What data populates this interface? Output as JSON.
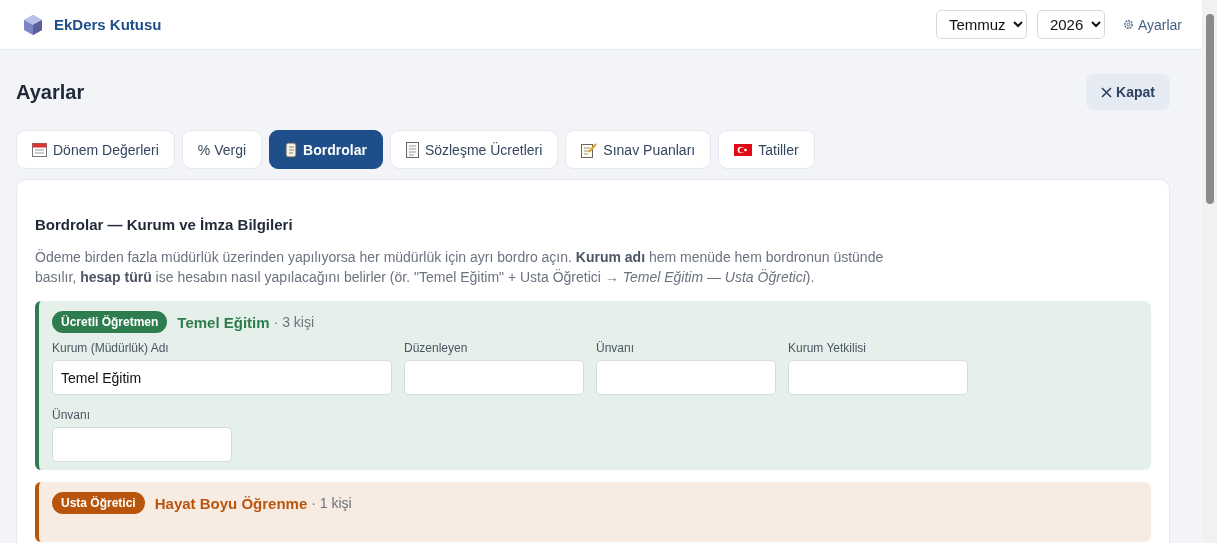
{
  "app": {
    "title": "EkDers Kutusu",
    "month": "Temmuz",
    "year": "2026",
    "settings_link": "Ayarlar"
  },
  "page": {
    "title": "Ayarlar",
    "close_button": "Kapat"
  },
  "tabs": [
    {
      "label": "Dönem Değerleri",
      "selected": false
    },
    {
      "label": "% Vergi",
      "selected": false
    },
    {
      "label": "Bordrolar",
      "selected": true
    },
    {
      "label": "Sözleşme Ücretleri",
      "selected": false
    },
    {
      "label": "Sınav Puanları",
      "selected": false
    },
    {
      "label": "Tatiller",
      "selected": false
    }
  ],
  "panel": {
    "heading": "Bordrolar — Kurum ve İmza Bilgileri",
    "description": "Ödeme birden fazla müdürlük üzerinden yapılıyorsa her müdürlük için ayrı bordro açın. **Kurum adı** hem menüde hem bordronun üstünde basılır, **hesap türü** ise hesabın nasıl yapılacağını belirler (ör. \"Temel Eğitim\" + Usta Öğretici → *Temel Eğitim — Usta Öğretici*)."
  },
  "payrolls": [
    {
      "badge": "Ücretli Öğretmen",
      "name": "Temel Eğitim",
      "count": "· 3 kişi",
      "color": "#2e7d4f",
      "fields": [
        {
          "label": "Kurum (Müdürlük) Adı",
          "value": "Temel Eğitim"
        },
        {
          "label": "Düzenleyen"
        },
        {
          "label": "Ünvanı"
        },
        {
          "label": "Kurum Yetkilisi"
        },
        {
          "label": "Ünvanı"
        }
      ]
    },
    {
      "badge": "Usta Öğretici",
      "name": "Hayat Boyu Öğrenme",
      "count": "· 1 kişi",
      "color": "#b8540c"
    }
  ]
}
